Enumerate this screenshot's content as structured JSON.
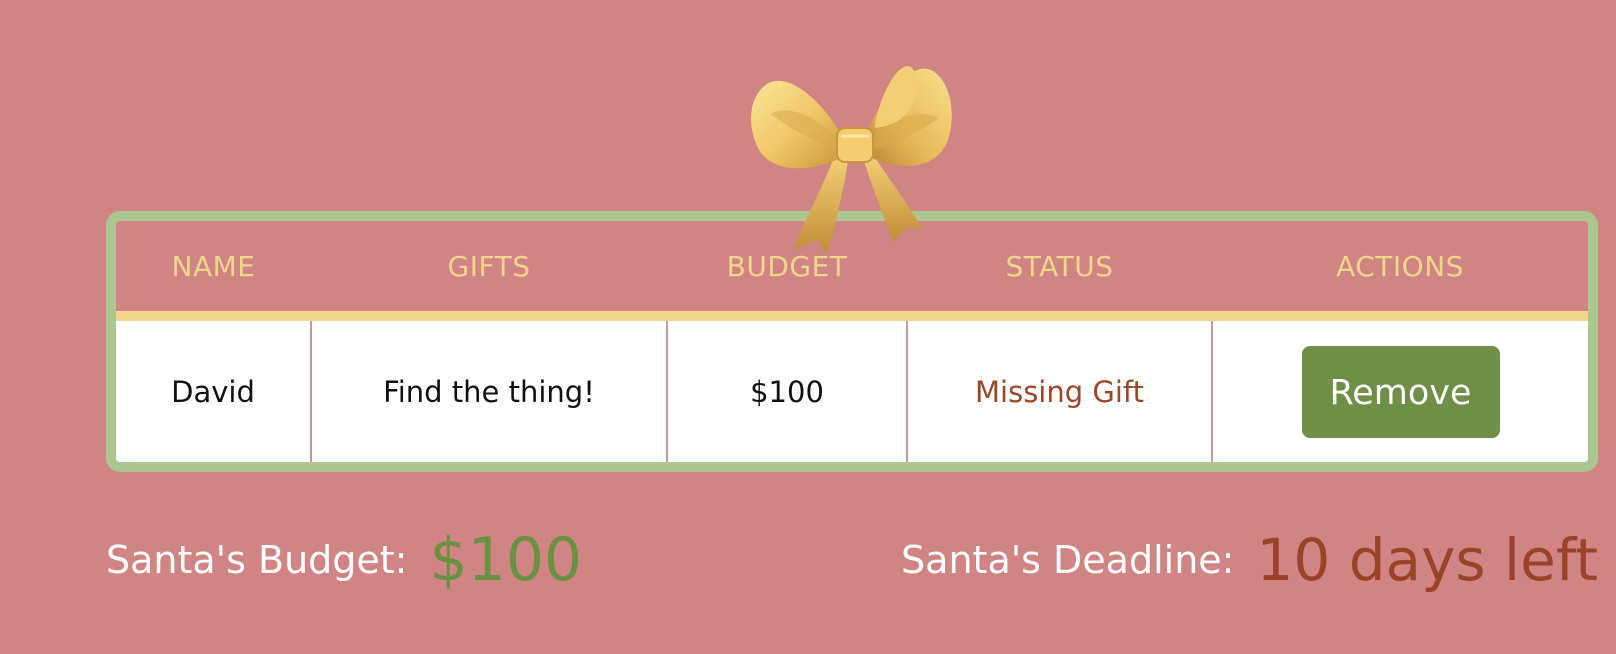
{
  "colors": {
    "background": "#d08584",
    "table_border": "#abc78f",
    "header_text": "#f0d58c",
    "header_rule": "#f1d68b",
    "status_missing": "#9b4729",
    "remove_button": "#6f8f47",
    "budget_value": "#6a9140",
    "deadline_value": "#9a4328"
  },
  "decoration": {
    "bow_icon": "gold-ribbon-bow-icon"
  },
  "table": {
    "headers": {
      "name": "NAME",
      "gifts": "GIFTS",
      "budget": "BUDGET",
      "status": "STATUS",
      "actions": "ACTIONS"
    },
    "rows": [
      {
        "name": "David",
        "gifts": "Find the thing!",
        "budget": "$100",
        "status": "Missing Gift",
        "action_label": "Remove"
      }
    ]
  },
  "footer": {
    "budget_label": "Santa's Budget:",
    "budget_value": "$100",
    "deadline_label": "Santa's Deadline:",
    "deadline_value": "10 days left"
  }
}
